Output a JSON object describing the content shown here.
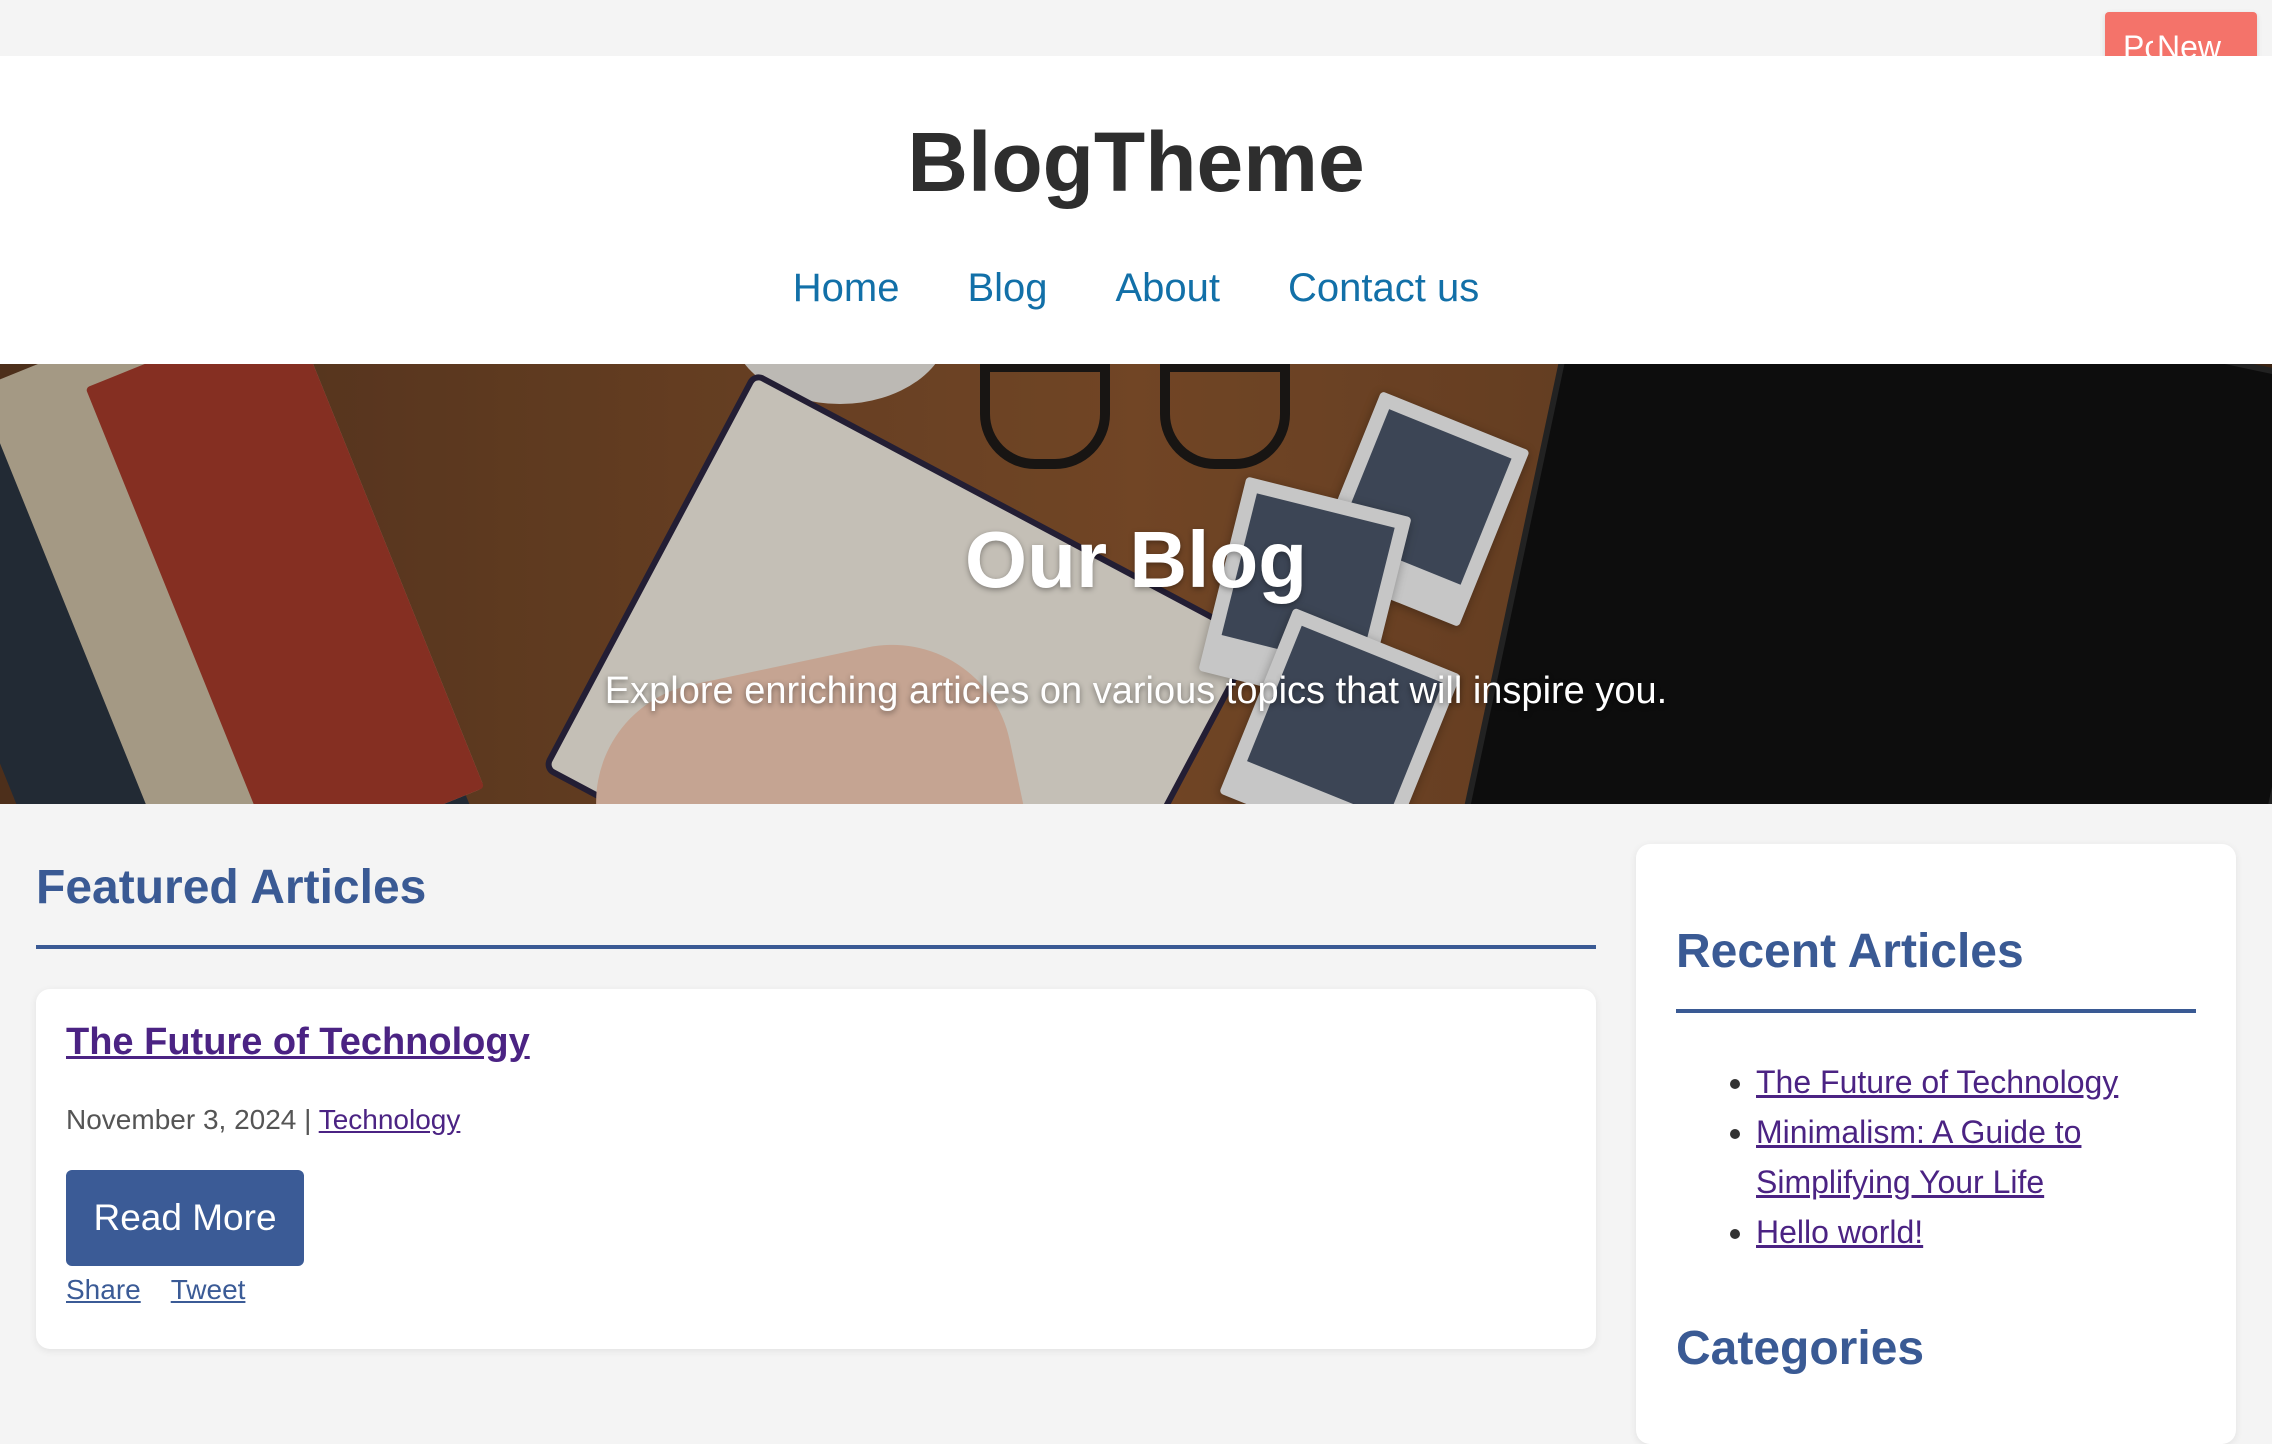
{
  "floating_button": {
    "clipped_label": "Po",
    "label": "New"
  },
  "header": {
    "site_title": "BlogTheme",
    "nav": [
      "Home",
      "Blog",
      "About",
      "Contact us"
    ]
  },
  "hero": {
    "title": "Our Blog",
    "subtitle": "Explore enriching articles on various topics that will inspire you."
  },
  "main": {
    "section_title": "Featured Articles",
    "articles": [
      {
        "title": "The Future of Technology",
        "date": "November 3, 2024",
        "separator": "|",
        "category": "Technology",
        "read_more": "Read More",
        "share": "Share",
        "tweet": "Tweet"
      }
    ]
  },
  "sidebar": {
    "recent_title": "Recent Articles",
    "recent": [
      "The Future of Technology",
      "Minimalism: A Guide to Simplifying Your Life",
      "Hello world!"
    ],
    "categories_title": "Categories"
  },
  "colors": {
    "accent": "#3a5a94",
    "nav_link": "#1270a8",
    "visited_link": "#4b2383",
    "floating_button": "#f4736a"
  }
}
